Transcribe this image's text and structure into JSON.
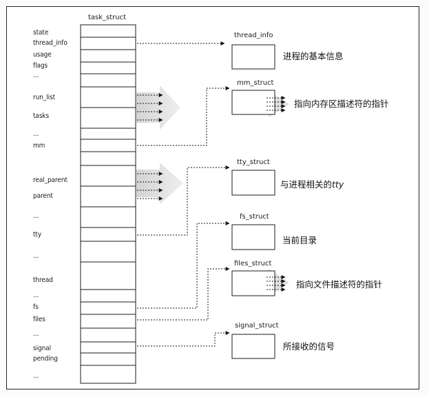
{
  "diagram": {
    "task_struct": {
      "title": "task_struct",
      "fields": {
        "state": "state",
        "thread_info": "thread_info",
        "usage": "usage",
        "flags": "flags",
        "ellipsis1": "...",
        "run_list": "run_list",
        "tasks": "tasks",
        "ellipsis2": "...",
        "mm": "mm",
        "real_parent": "real_parent",
        "parent": "parent",
        "ellipsis3": "...",
        "tty": "tty",
        "ellipsis4": "...",
        "thread": "thread",
        "ellipsis5": "...",
        "fs": "fs",
        "files": "files",
        "ellipsis6": "...",
        "signal": "signal",
        "pending": "pending",
        "ellipsis7": "..."
      }
    },
    "structs": {
      "thread_info": {
        "label": "thread_info",
        "desc": "进程的基本信息"
      },
      "mm_struct": {
        "label": "mm_struct",
        "desc": "指向内存区描述符的指针"
      },
      "tty_struct": {
        "label": "tty_struct",
        "desc_prefix": "与进程相关的",
        "desc_italic": "tty"
      },
      "fs_struct": {
        "label": "fs_struct",
        "desc": "当前目录"
      },
      "files_struct": {
        "label": "files_struct",
        "desc": "指向文件描述符的指针"
      },
      "signal_struct": {
        "label": "signal_struct",
        "desc": "所接收的信号"
      }
    }
  }
}
